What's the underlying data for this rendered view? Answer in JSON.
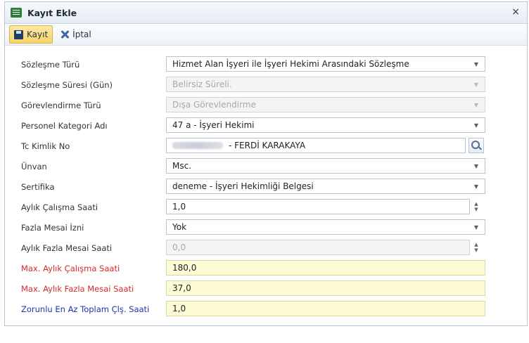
{
  "window": {
    "title": "Kayıt Ekle",
    "close_label": "×"
  },
  "toolbar": {
    "save_label": "Kayıt",
    "cancel_label": "İptal"
  },
  "fields": {
    "contract_type": {
      "label": "Sözleşme Türü",
      "value": "Hizmet Alan İşyeri ile İşyeri Hekimi Arasındaki Sözleşme"
    },
    "contract_duration": {
      "label": "Sözleşme Süresi (Gün)",
      "value": "Belirsiz Süreli."
    },
    "assignment_type": {
      "label": "Görevlendirme Türü",
      "value": "Dışa Görevlendirme"
    },
    "personnel_category": {
      "label": "Personel Kategori Adı",
      "value": "47 a - İşyeri Hekimi"
    },
    "tc_id": {
      "label": "Tc Kimlik No",
      "value": "- FERDİ KARAKAYA"
    },
    "title_field": {
      "label": "Ünvan",
      "value": "Msc."
    },
    "certificate": {
      "label": "Sertifika",
      "value": "deneme - İşyeri Hekimliği Belgesi"
    },
    "monthly_work_hours": {
      "label": "Aylık Çalışma Saati",
      "value": "1,0"
    },
    "overtime_permission": {
      "label": "Fazla Mesai İzni",
      "value": "Yok"
    },
    "monthly_overtime_hours": {
      "label": "Aylık Fazla Mesai Saati",
      "value": "0,0"
    },
    "max_monthly_work_hours": {
      "label": "Max. Aylık Çalışma Saati",
      "value": "180,0"
    },
    "max_monthly_overtime_hours": {
      "label": "Max. Aylık Fazla Mesai Saati",
      "value": "37,0"
    },
    "min_total_work_hours": {
      "label": "Zorunlu En Az Toplam Çlş. Saati",
      "value": "1,0"
    }
  },
  "colors": {
    "required_label": "#d42a2a",
    "computed_label": "#1e34a8",
    "readonly_bg": "#fdfbd4",
    "save_highlight": "#f7d46a"
  },
  "icons": {
    "window": "form-icon",
    "save": "floppy-disk-icon",
    "cancel": "x-icon",
    "search": "magnifier-icon"
  }
}
